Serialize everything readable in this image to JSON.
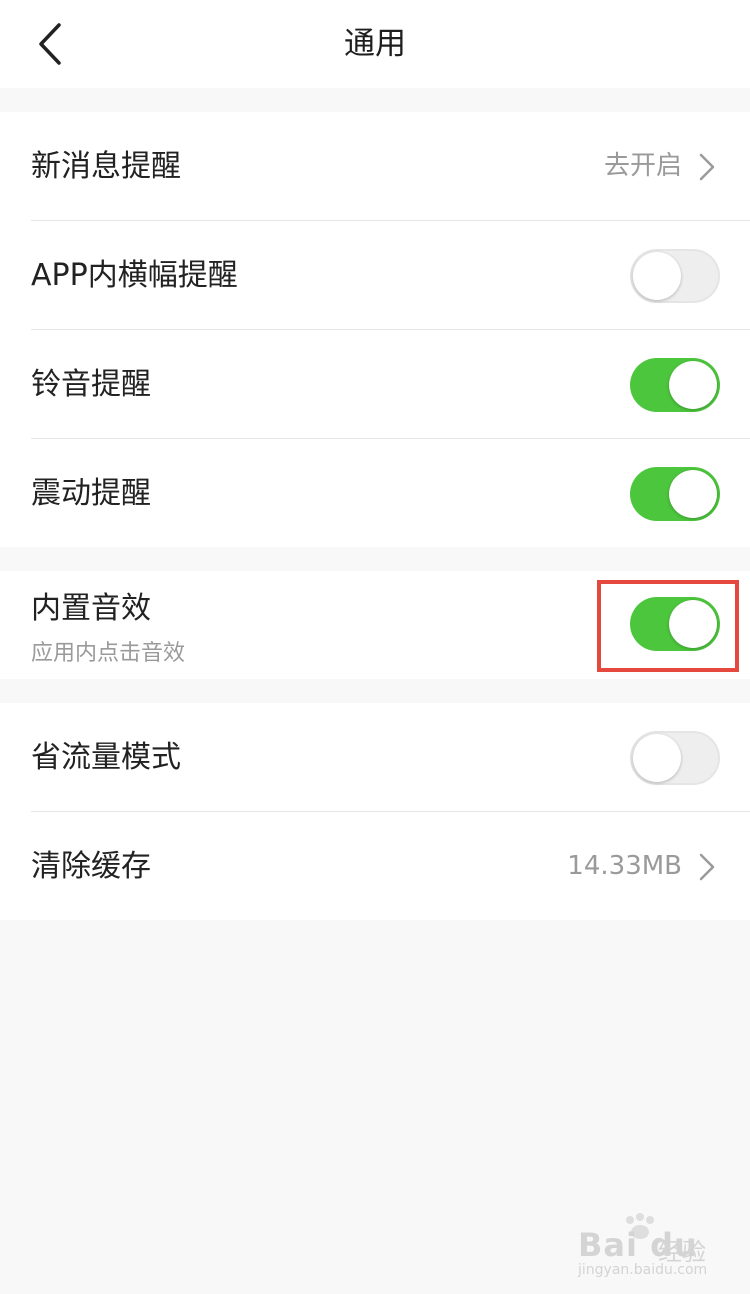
{
  "navbar": {
    "title": "通用",
    "back_icon": "chevron-left-icon"
  },
  "groups": {
    "notifications": {
      "new_message": {
        "label": "新消息提醒",
        "value": "去开启"
      },
      "banner": {
        "label": "APP内横幅提醒",
        "enabled": false
      },
      "ringtone": {
        "label": "铃音提醒",
        "enabled": true
      },
      "vibration": {
        "label": "震动提醒",
        "enabled": true
      }
    },
    "sound": {
      "builtin_sound": {
        "label": "内置音效",
        "sublabel": "应用内点击音效",
        "enabled": true
      }
    },
    "data": {
      "data_saver": {
        "label": "省流量模式",
        "enabled": false
      },
      "clear_cache": {
        "label": "清除缓存",
        "value": "14.33MB"
      }
    }
  },
  "annotation": {
    "highlight_color": "#e5483f",
    "target": "builtin_sound toggle"
  },
  "watermark": {
    "brand": "Bai du",
    "cn": "经验",
    "url": "jingyan.baidu.com"
  },
  "colors": {
    "toggle_on": "#4cc63c",
    "toggle_off": "#eeeeee",
    "background": "#f8f8f8"
  }
}
